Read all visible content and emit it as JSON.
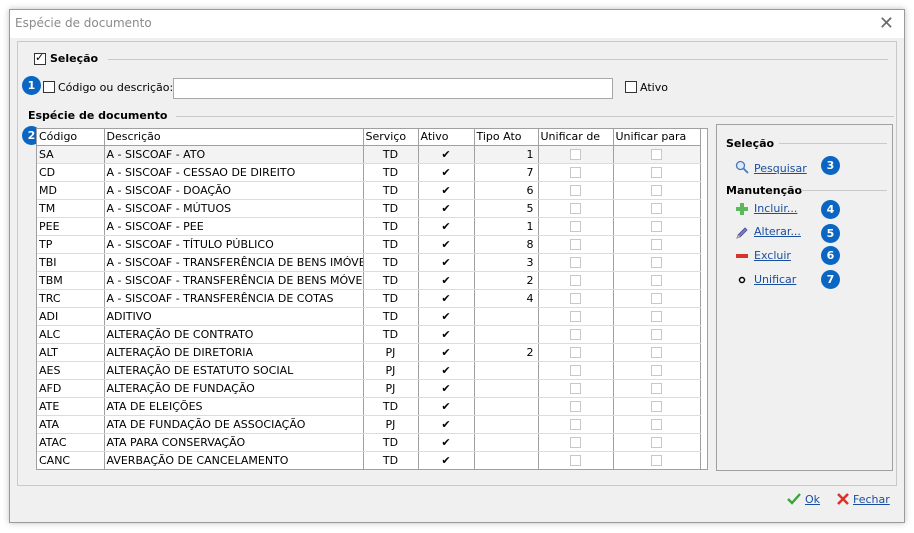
{
  "window": {
    "title": "Espécie de documento"
  },
  "selecao": {
    "legend": "Seleção",
    "filter_label": "Código ou descrição:",
    "filter_value": "",
    "ativo_label": "Ativo"
  },
  "grid": {
    "legend": "Espécie de documento",
    "columns": [
      "Código",
      "Descrição",
      "Serviço",
      "Ativo",
      "Tipo Ato",
      "Unificar de",
      "Unificar para"
    ],
    "rows": [
      {
        "codigo": "SA",
        "descricao": "A - SISCOAF - ATO",
        "servico": "TD",
        "ativo": true,
        "tipo": "1"
      },
      {
        "codigo": "CD",
        "descricao": "A - SISCOAF - CESSAO DE DIREITO",
        "servico": "TD",
        "ativo": true,
        "tipo": "7"
      },
      {
        "codigo": "MD",
        "descricao": "A - SISCOAF - DOAÇÃO",
        "servico": "TD",
        "ativo": true,
        "tipo": "6"
      },
      {
        "codigo": "TM",
        "descricao": "A - SISCOAF - MÚTUOS",
        "servico": "TD",
        "ativo": true,
        "tipo": "5"
      },
      {
        "codigo": "PEE",
        "descricao": "A - SISCOAF - PEE",
        "servico": "TD",
        "ativo": true,
        "tipo": "1"
      },
      {
        "codigo": "TP",
        "descricao": "A - SISCOAF - TÍTULO PÚBLICO",
        "servico": "TD",
        "ativo": true,
        "tipo": "8"
      },
      {
        "codigo": "TBI",
        "descricao": "A - SISCOAF - TRANSFERÊNCIA DE BENS IMÓVEIS",
        "servico": "TD",
        "ativo": true,
        "tipo": "3"
      },
      {
        "codigo": "TBM",
        "descricao": "A - SISCOAF - TRANSFERÊNCIA DE BENS MÓVEIS",
        "servico": "TD",
        "ativo": true,
        "tipo": "2"
      },
      {
        "codigo": "TRC",
        "descricao": "A - SISCOAF - TRANSFERÊNCIA DE COTAS",
        "servico": "TD",
        "ativo": true,
        "tipo": "4"
      },
      {
        "codigo": "ADI",
        "descricao": "ADITIVO",
        "servico": "TD",
        "ativo": true,
        "tipo": ""
      },
      {
        "codigo": "ALC",
        "descricao": "ALTERAÇÃO DE CONTRATO",
        "servico": "TD",
        "ativo": true,
        "tipo": ""
      },
      {
        "codigo": "ALT",
        "descricao": "ALTERAÇÃO DE DIRETORIA",
        "servico": "PJ",
        "ativo": true,
        "tipo": "2"
      },
      {
        "codigo": "AES",
        "descricao": "ALTERAÇÃO DE ESTATUTO SOCIAL",
        "servico": "PJ",
        "ativo": true,
        "tipo": ""
      },
      {
        "codigo": "AFD",
        "descricao": "ALTERAÇÃO DE FUNDAÇÃO",
        "servico": "PJ",
        "ativo": true,
        "tipo": ""
      },
      {
        "codigo": "ATE",
        "descricao": "ATA DE ELEIÇÕES",
        "servico": "TD",
        "ativo": true,
        "tipo": ""
      },
      {
        "codigo": "ATA",
        "descricao": "ATA DE FUNDAÇÃO DE ASSOCIAÇÃO",
        "servico": "PJ",
        "ativo": true,
        "tipo": ""
      },
      {
        "codigo": "ATAC",
        "descricao": "ATA PARA CONSERVAÇÃO",
        "servico": "TD",
        "ativo": true,
        "tipo": ""
      },
      {
        "codigo": "CANC",
        "descricao": "AVERBAÇÃO DE CANCELAMENTO",
        "servico": "TD",
        "ativo": true,
        "tipo": ""
      }
    ]
  },
  "side": {
    "selecao_title": "Seleção",
    "pesquisar": "Pesquisar",
    "manutencao_title": "Manutenção",
    "incluir": "Incluir...",
    "alterar": "Alterar...",
    "excluir": "Excluir",
    "unificar": "Unificar"
  },
  "badges": [
    "1",
    "2",
    "3",
    "4",
    "5",
    "6",
    "7"
  ],
  "footer": {
    "ok": "Ok",
    "fechar": "Fechar"
  },
  "colors": {
    "badge": "#0a66c2",
    "link": "#1a4fa0",
    "ok_green": "#3aa53a",
    "close_red": "#d9342b"
  }
}
